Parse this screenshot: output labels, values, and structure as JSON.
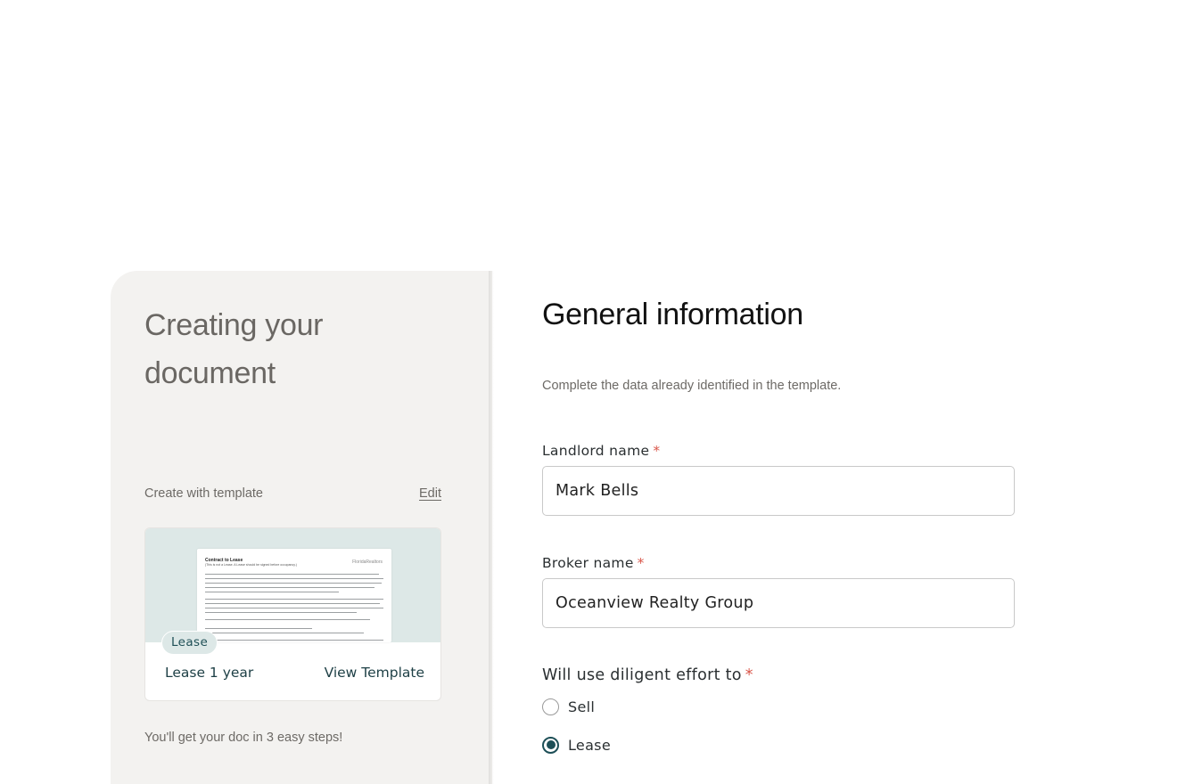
{
  "sidebar": {
    "title": "Creating your document",
    "template_label": "Create with template",
    "edit_label": "Edit",
    "template_card": {
      "badge": "Lease",
      "name": "Lease 1 year",
      "view_label": "View Template",
      "preview": {
        "heading": "Contract to Lease",
        "subheading": "(This is not a Lease. A Lease should be signed before occupancy.)",
        "logo": "FloridaRealtors"
      }
    },
    "steps_text": "You'll get your doc in 3 easy steps!"
  },
  "form": {
    "title": "General information",
    "subtitle": "Complete the data already identified in the template.",
    "required_mark": "*",
    "landlord": {
      "label": "Landlord name",
      "value": "Mark Bells"
    },
    "broker": {
      "label": "Broker name",
      "value": "Oceanview Realty Group"
    },
    "diligent_effort": {
      "label": "Will use diligent effort to",
      "options": [
        {
          "label": "Sell",
          "selected": false
        },
        {
          "label": "Lease",
          "selected": true
        }
      ]
    }
  },
  "colors": {
    "accent": "#1d4f57",
    "required": "#d9574b",
    "panel_bg": "#f3f2f0",
    "preview_bg": "#dde8e7"
  }
}
